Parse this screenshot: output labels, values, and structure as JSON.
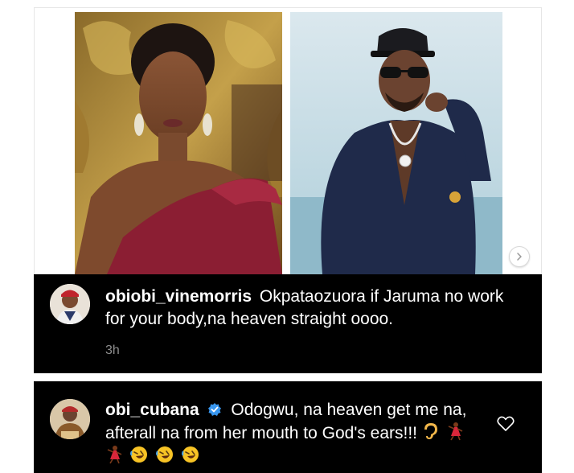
{
  "post": {
    "image_count_hint": "2 photos"
  },
  "comments": [
    {
      "username": "obiobi_vinemorris",
      "text": "Okpataozuora if Jaruma no work for your body,na heaven straight oooo.",
      "time": "3h",
      "avatar_icon": "user-avatar"
    },
    {
      "username": "obi_cubana",
      "verified": true,
      "text": "Odogwu, na heaven get me na, afterall na from her mouth to God's ears!!!",
      "emojis": [
        "ear",
        "dancer",
        "dancer",
        "rofl",
        "rofl",
        "rofl"
      ],
      "avatar_icon": "user-avatar"
    }
  ],
  "colors": {
    "comment_bg": "#000000",
    "text": "#ffffff",
    "meta": "#8e8e8e",
    "verified": "#3897f0"
  }
}
